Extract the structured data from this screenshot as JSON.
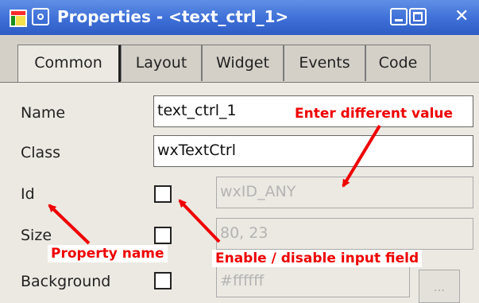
{
  "window": {
    "title": "Properties - <text_ctrl_1>",
    "title_bar_color": "#3e6fd7"
  },
  "tabs": [
    {
      "label": "Common",
      "active": true
    },
    {
      "label": "Layout",
      "active": false
    },
    {
      "label": "Widget",
      "active": false
    },
    {
      "label": "Events",
      "active": false
    },
    {
      "label": "Code",
      "active": false
    }
  ],
  "properties": {
    "name": {
      "label": "Name",
      "value": "text_ctrl_1"
    },
    "class": {
      "label": "Class",
      "value": "wxTextCtrl"
    },
    "id": {
      "label": "Id",
      "value": "wxID_ANY",
      "enabled": false
    },
    "size": {
      "label": "Size",
      "value": "80, 23",
      "enabled": false
    },
    "background": {
      "label": "Background",
      "value": "#ffffff",
      "enabled": false,
      "button_label": "..."
    }
  },
  "annotations": {
    "enter_value": "Enter different value",
    "property_name": "Property name",
    "enable_disable": "Enable / disable input field",
    "annotation_color": "#ee0000"
  }
}
